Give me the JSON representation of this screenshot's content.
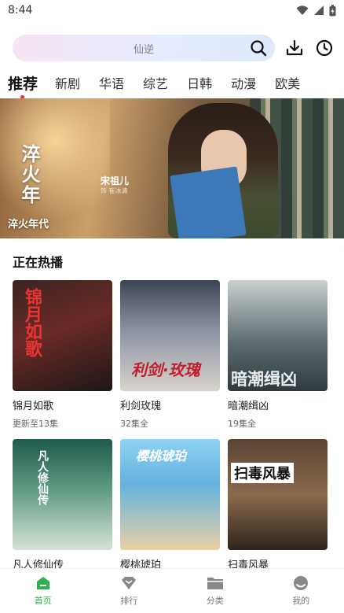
{
  "status_bar": {
    "time": "8:44"
  },
  "search": {
    "placeholder": "仙逆"
  },
  "tabs": [
    {
      "label": "推荐",
      "active": true
    },
    {
      "label": "新剧"
    },
    {
      "label": "华语"
    },
    {
      "label": "综艺"
    },
    {
      "label": "日韩"
    },
    {
      "label": "动漫"
    },
    {
      "label": "欧美"
    }
  ],
  "banner": {
    "vertical_text": "淬火年",
    "actor_name": "宋祖儿",
    "actor_role": "饰 崔冰清",
    "title": "淬火年代"
  },
  "section": {
    "title": "正在热播"
  },
  "shows": [
    {
      "title": "锦月如歌",
      "subtitle": "更新至13集",
      "poster_text": "锦月如歌",
      "color": "#6a2a26"
    },
    {
      "title": "利剑玫瑰",
      "subtitle": "32集全",
      "poster_text": "利剑·玫瑰",
      "color": "#8b93a3"
    },
    {
      "title": "暗潮缉凶",
      "subtitle": "19集全",
      "poster_text": "暗潮缉凶",
      "color": "#5f6e72"
    },
    {
      "title": "凡人修仙传",
      "subtitle": "",
      "poster_text": "凡人修仙传",
      "color": "#5f9a82"
    },
    {
      "title": "樱桃琥珀",
      "subtitle": "",
      "poster_text": "樱桃琥珀",
      "color": "#64b2df"
    },
    {
      "title": "扫毒风暴",
      "subtitle": "",
      "poster_text": "扫毒风暴",
      "color": "#8a6a4c"
    }
  ],
  "nav": [
    {
      "label": "首页",
      "icon": "home-icon",
      "active": true
    },
    {
      "label": "排行",
      "icon": "ranking-icon"
    },
    {
      "label": "分类",
      "icon": "folder-icon"
    },
    {
      "label": "我的",
      "icon": "profile-icon"
    }
  ],
  "colors": {
    "accent": "#2cb24e",
    "tab_dot": "#e8322e"
  }
}
